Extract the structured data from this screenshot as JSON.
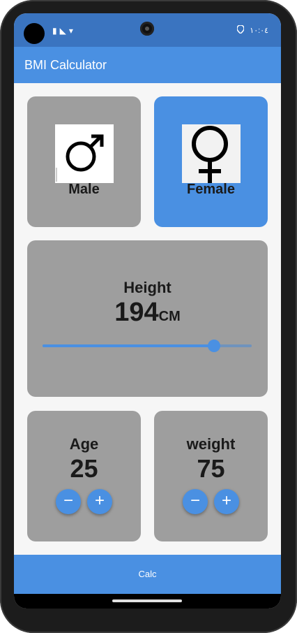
{
  "status_bar": {
    "left_icons": "▮◣▾",
    "right_text": "١٠:٠٤",
    "right_icon": "location-icon"
  },
  "app_bar": {
    "title": "BMI Calculator"
  },
  "gender": {
    "male": {
      "label": "Male",
      "icon": "male-symbol-icon",
      "selected": false
    },
    "female": {
      "label": "Female",
      "icon": "female-symbol-icon",
      "selected": true
    }
  },
  "height": {
    "label": "Height",
    "value": "194",
    "unit": "CM",
    "slider_fraction": 0.82
  },
  "age": {
    "label": "Age",
    "value": "25",
    "minus": "−",
    "plus": "+"
  },
  "weight": {
    "label": "weight",
    "value": "75",
    "minus": "−",
    "plus": "+"
  },
  "calc_button": {
    "label": "Calc"
  },
  "colors": {
    "primary": "#4a90e2",
    "card": "#9e9e9e",
    "status_bar": "#3a74c0"
  }
}
